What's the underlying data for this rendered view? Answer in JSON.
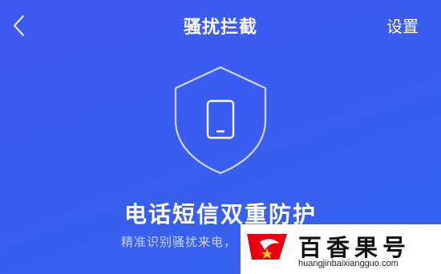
{
  "header": {
    "back_icon": "chevron-left-icon",
    "title": "骚扰拦截",
    "settings_label": "设置"
  },
  "hero": {
    "icon": "shield-phone-icon",
    "headline": "电话短信双重防护",
    "subtext": "精准识别骚扰来电，"
  },
  "watermark": {
    "name": "百香果号",
    "url": "huangjinbaixiangguo.com",
    "logo_colors": [
      "#e60012",
      "#ffffff"
    ]
  },
  "colors": {
    "background": "#3a5cf0",
    "text": "#ffffff",
    "shield_stroke": "#cfd6ff"
  }
}
